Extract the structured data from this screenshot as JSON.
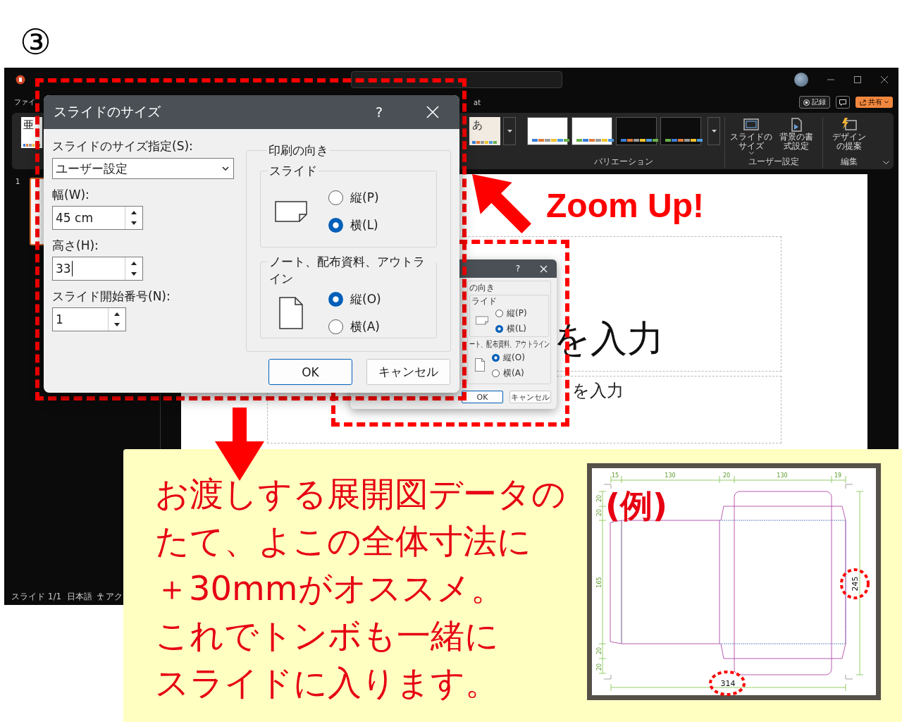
{
  "step_marker": "③",
  "window": {
    "menu": [
      "ファイ",
      "at"
    ],
    "record_button": "記録",
    "share_button": "共有",
    "ribbon": {
      "themes": [
        "亜",
        "あ"
      ],
      "variants": [
        {
          "kind": "light"
        },
        {
          "kind": "light"
        },
        {
          "kind": "dark"
        },
        {
          "kind": "dark"
        }
      ],
      "variants_label": "バリエーション",
      "buttons": [
        {
          "lines": [
            "スライドの",
            "サイズ"
          ],
          "dropdown": true
        },
        {
          "lines": [
            "背景の書",
            "式設定"
          ],
          "dropdown": false
        },
        {
          "lines": [
            "デザイン",
            "の提案"
          ],
          "dropdown": false
        }
      ],
      "groups": [
        "ユーザー設定",
        "編集"
      ]
    },
    "slide_number": "1",
    "slide": {
      "title": "を入力",
      "subtitle": "を入力"
    },
    "status_bar": {
      "slide": "スライド 1/1",
      "language": "日本語",
      "accessibility": "アク"
    }
  },
  "size_dialog": {
    "title": "スライドのサイズ",
    "help": "?",
    "size_label": "スライドのサイズ指定(S):",
    "size_value": "ユーザー設定",
    "width_label": "幅(W):",
    "width_value": "45 cm",
    "height_label": "高さ(H):",
    "height_value": "33",
    "height_focused": true,
    "start_label": "スライド開始番号(N):",
    "start_value": "1",
    "orientation_label": "印刷の向き",
    "slide_group": "スライド",
    "slide_options": [
      {
        "label": "縦(P)",
        "selected": false
      },
      {
        "label": "横(L)",
        "selected": true
      }
    ],
    "notes_group": "ノート、配布資料、アウトライン",
    "notes_options": [
      {
        "label": "縦(O)",
        "selected": true
      },
      {
        "label": "横(A)",
        "selected": false
      }
    ],
    "ok_button": "OK",
    "cancel_button": "キャンセル"
  },
  "small_dialog": {
    "help": "?",
    "orientation_label": "の向き",
    "slide_group": "ライド",
    "slide_options": [
      {
        "label": "縦(P)",
        "selected": false
      },
      {
        "label": "横(L)",
        "selected": true
      }
    ],
    "notes_group": "ート、配布資料、アウトライン",
    "notes_options": [
      {
        "label": "縦(O)",
        "selected": true
      },
      {
        "label": "横(A)",
        "selected": false
      }
    ],
    "ok_button": "OK",
    "cancel_button": "キャンセル"
  },
  "zoom_label": "Zoom Up!",
  "tip": {
    "lines": [
      "お渡しする展開図データの",
      "たて、よこの全体寸法に",
      "＋30mmがオススメ。",
      "これでトンボも一緒に",
      "スライドに入ります。"
    ]
  },
  "example": {
    "label": "(例)",
    "top_dimensions": [
      "15",
      "130",
      "20",
      "130",
      "19"
    ],
    "left_dimensions": [
      "20",
      "20",
      "165",
      "20",
      "20"
    ],
    "height_total": "245",
    "width_total": "314"
  }
}
